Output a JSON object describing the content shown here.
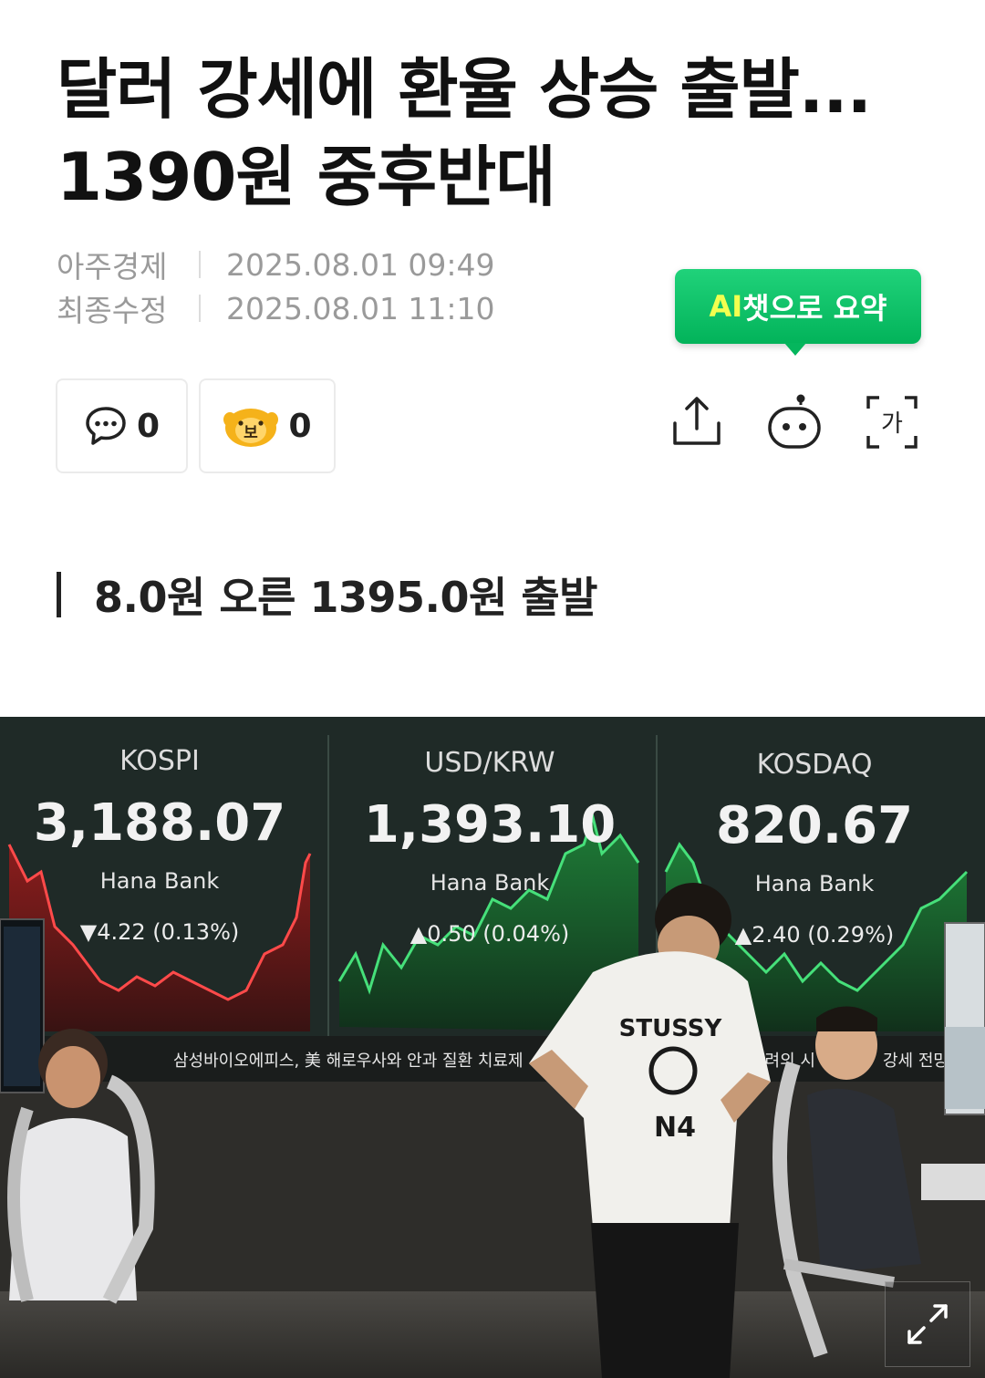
{
  "article": {
    "title_line1": "달러 강세에 환율 상승 출발...",
    "title_line2": "1390원 중후반대",
    "publisher": "아주경제",
    "published": "2025.08.01 09:49",
    "modified_label": "최종수정",
    "modified": "2025.08.01 11:10",
    "subheading": "8.0원 오른 1395.0원 출발"
  },
  "ai_summary": {
    "prefix": "AI",
    "suffix": "챗으로 요약"
  },
  "reactions": {
    "comments_count": "0",
    "like_count": "0",
    "like_icon": "bear-face-icon",
    "like_char": "보"
  },
  "toolbar": {
    "share_icon": "share-icon",
    "bot_icon": "ai-bot-icon",
    "font_icon": "font-size-icon",
    "font_char": "가"
  },
  "photo": {
    "panels": [
      {
        "name": "KOSPI",
        "value": "3,188.07",
        "brand": "Hana Bank",
        "change": "▼4.22 (0.13%)",
        "direction": "down"
      },
      {
        "name": "USD/KRW",
        "value": "1,393.10",
        "brand": "Hana Bank",
        "change": "▲0.50 (0.04%)",
        "direction": "up"
      },
      {
        "name": "KOSDAQ",
        "value": "820.67",
        "brand": "Hana Bank",
        "change": "▲2.40 (0.29%)",
        "direction": "up"
      }
    ],
    "ticker_left": "삼성바이오에피스, 美 해로우사와 안과 질환 치료제",
    "ticker_right_a": "우려의 시",
    "ticker_right_b": "강세 전망",
    "shirt_brand": "STUSSY",
    "shirt_text": "N4"
  },
  "colors": {
    "accent_green": "#03b45b",
    "ai_text": "#f3ff4f",
    "down": "#e23b3b",
    "up": "#3bd36a"
  }
}
